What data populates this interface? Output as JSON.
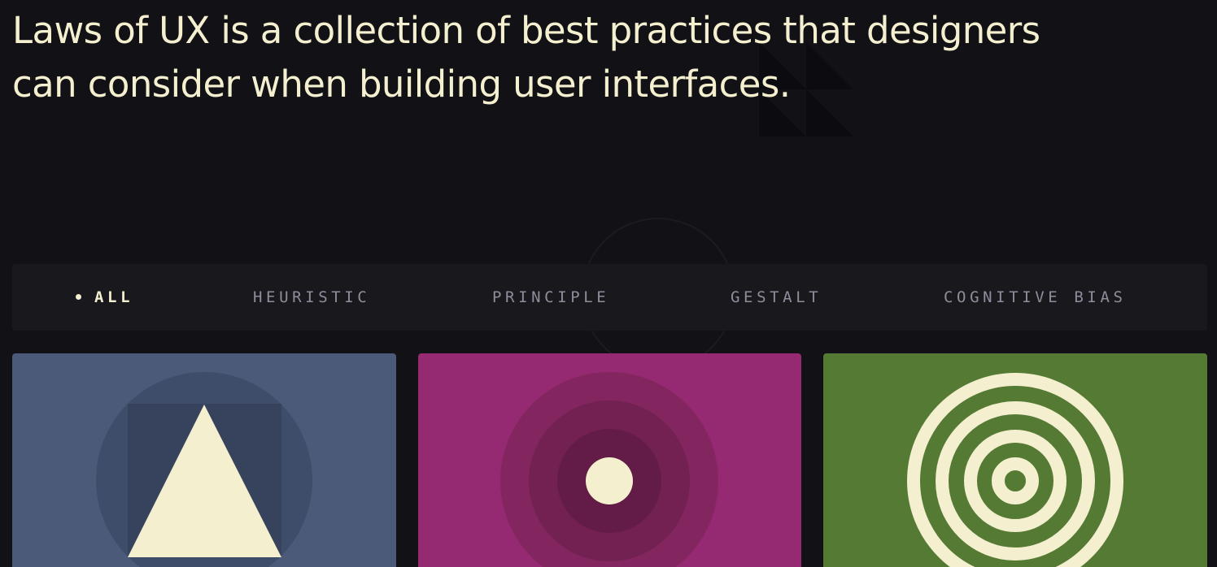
{
  "headline": {
    "line1": "Laws of UX is a collection of best practices that designers",
    "line2": "can consider when building user interfaces."
  },
  "filters": [
    {
      "label": "ALL",
      "active": true
    },
    {
      "label": "HEURISTIC",
      "active": false
    },
    {
      "label": "PRINCIPLE",
      "active": false
    },
    {
      "label": "GESTALT",
      "active": false
    },
    {
      "label": "COGNITIVE BIAS",
      "active": false
    }
  ],
  "colors": {
    "background": "#111116",
    "filter_bar": "#18181d",
    "text_cream": "#f3efcf",
    "filter_inactive": "#8f8d9c",
    "card_blue": "#4a5a78",
    "card_magenta": "#952a72",
    "card_green": "#557a34"
  },
  "cards": [
    {
      "icon": "triangle-in-square-in-circle-icon",
      "color": "#4a5a78"
    },
    {
      "icon": "concentric-circles-dot-icon",
      "color": "#952a72"
    },
    {
      "icon": "target-rings-icon",
      "color": "#557a34"
    }
  ]
}
